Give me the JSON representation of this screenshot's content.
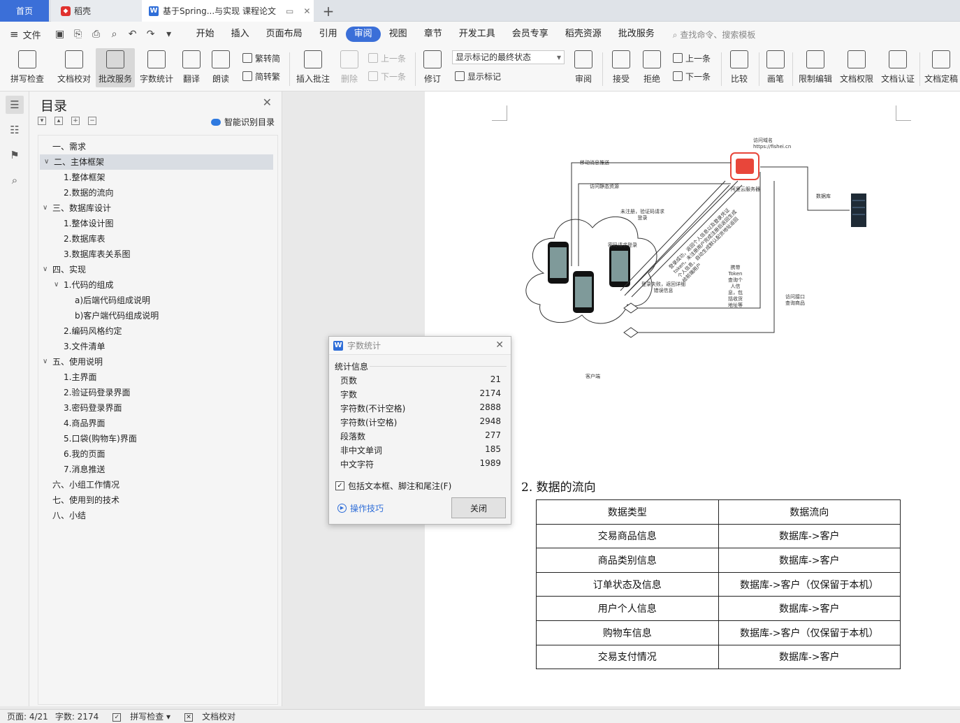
{
  "tabs": {
    "home": "首页",
    "daoke": "稻壳",
    "doc": "基于Spring...与实现 课程论文"
  },
  "menu": {
    "file": "文件",
    "items": [
      "开始",
      "插入",
      "页面布局",
      "引用",
      "审阅",
      "视图",
      "章节",
      "开发工具",
      "会员专享",
      "稻壳资源",
      "批改服务"
    ],
    "active": "审阅",
    "search": "查找命令、搜索模板"
  },
  "ribbon": {
    "spell": "拼写检查",
    "proof": "文档校对",
    "correct": "批改服务",
    "count": "字数统计",
    "translate": "翻译",
    "read": "朗读",
    "trad2simp": "繁转简",
    "simp2trad": "简转繁",
    "insert_comment": "插入批注",
    "delete": "删除",
    "prev": "上一条",
    "next": "下一条",
    "revise": "修订",
    "markup_state": "显示标记的最终状态",
    "show_markup": "显示标记",
    "review": "审阅",
    "accept": "接受",
    "reject": "拒绝",
    "prev2": "上一条",
    "next2": "下一条",
    "compare": "比较",
    "pen": "画笔",
    "restrict": "限制编辑",
    "permission": "文档权限",
    "certify": "文档认证",
    "finalize": "文档定稿"
  },
  "toc": {
    "title": "目录",
    "smart": "智能识别目录",
    "items": [
      {
        "text": "一、需求",
        "level": 0,
        "arrow": ""
      },
      {
        "text": "二、主体框架",
        "level": 0,
        "arrow": "v",
        "selected": true
      },
      {
        "text": "1.整体框架",
        "level": 1,
        "arrow": ""
      },
      {
        "text": "2.数据的流向",
        "level": 1,
        "arrow": ""
      },
      {
        "text": "三、数据库设计",
        "level": 0,
        "arrow": "v"
      },
      {
        "text": "1.整体设计图",
        "level": 1,
        "arrow": ""
      },
      {
        "text": "2.数据库表",
        "level": 1,
        "arrow": ""
      },
      {
        "text": "3.数据库表关系图",
        "level": 1,
        "arrow": ""
      },
      {
        "text": "四、实现",
        "level": 0,
        "arrow": "v"
      },
      {
        "text": "1.代码的组成",
        "level": 1,
        "arrow": "v"
      },
      {
        "text": "a)后端代码组成说明",
        "level": 2,
        "arrow": ""
      },
      {
        "text": "b)客户端代码组成说明",
        "level": 2,
        "arrow": ""
      },
      {
        "text": "2.编码风格约定",
        "level": 1,
        "arrow": ""
      },
      {
        "text": "3.文件清单",
        "level": 1,
        "arrow": ""
      },
      {
        "text": "五、使用说明",
        "level": 0,
        "arrow": "v"
      },
      {
        "text": "1.主界面",
        "level": 1,
        "arrow": ""
      },
      {
        "text": "2.验证码登录界面",
        "level": 1,
        "arrow": ""
      },
      {
        "text": "3.密码登录界面",
        "level": 1,
        "arrow": ""
      },
      {
        "text": "4.商品界面",
        "level": 1,
        "arrow": ""
      },
      {
        "text": "5.口袋(购物车)界面",
        "level": 1,
        "arrow": ""
      },
      {
        "text": "6.我的页面",
        "level": 1,
        "arrow": ""
      },
      {
        "text": "7.消息推送",
        "level": 1,
        "arrow": ""
      },
      {
        "text": "六、小组工作情况",
        "level": 0,
        "arrow": ""
      },
      {
        "text": "七、使用到的技术",
        "level": 0,
        "arrow": ""
      },
      {
        "text": "八、小结",
        "level": 0,
        "arrow": ""
      }
    ]
  },
  "diagram": {
    "domain": "访问域名\nhttps://fishei.cn",
    "push": "移动消息推送",
    "static": "访问静态资源",
    "server": "阿里云服务器",
    "db": "数据库",
    "unregistered": "未注册，验证码请求\n登录",
    "pwd": "密码请求登录",
    "success": "登录成功，返回个人信息以及登录凭证\ntoken，未注册用户完成注册后返回生成\n个人信息，自动生成默认配货地址返回\n给前端用户",
    "fail": "登录失败，返回详细\n错误信息",
    "token": "携带\nToken\n查询个\n人信\n息，包\n括收货\n地址等",
    "api": "访问接口\n查询商品",
    "client": "客户端"
  },
  "doc": {
    "heading": "2.  数据的流向",
    "table_header": [
      "数据类型",
      "数据流向"
    ],
    "table_rows": [
      [
        "交易商品信息",
        "数据库->客户"
      ],
      [
        "商品类别信息",
        "数据库->客户"
      ],
      [
        "订单状态及信息",
        "数据库->客户（仅保留于本机）"
      ],
      [
        "用户个人信息",
        "数据库->客户"
      ],
      [
        "购物车信息",
        "数据库->客户（仅保留于本机）"
      ],
      [
        "交易支付情况",
        "数据库->客户"
      ]
    ]
  },
  "dialog": {
    "title": "字数统计",
    "section": "统计信息",
    "rows": [
      {
        "label": "页数",
        "value": "21"
      },
      {
        "label": "字数",
        "value": "2174"
      },
      {
        "label": "字符数(不计空格)",
        "value": "2888"
      },
      {
        "label": "字符数(计空格)",
        "value": "2948"
      },
      {
        "label": "段落数",
        "value": "277"
      },
      {
        "label": "非中文单词",
        "value": "185"
      },
      {
        "label": "中文字符",
        "value": "1989"
      }
    ],
    "include": "包括文本框、脚注和尾注(F)",
    "tips": "操作技巧",
    "close": "关闭"
  },
  "status": {
    "page": "页面: 4/21",
    "words": "字数: 2174",
    "spell": "拼写检查",
    "proof": "文档校对"
  },
  "colors": {
    "accent": "#3b6fd8",
    "server_red": "#e8463a"
  }
}
